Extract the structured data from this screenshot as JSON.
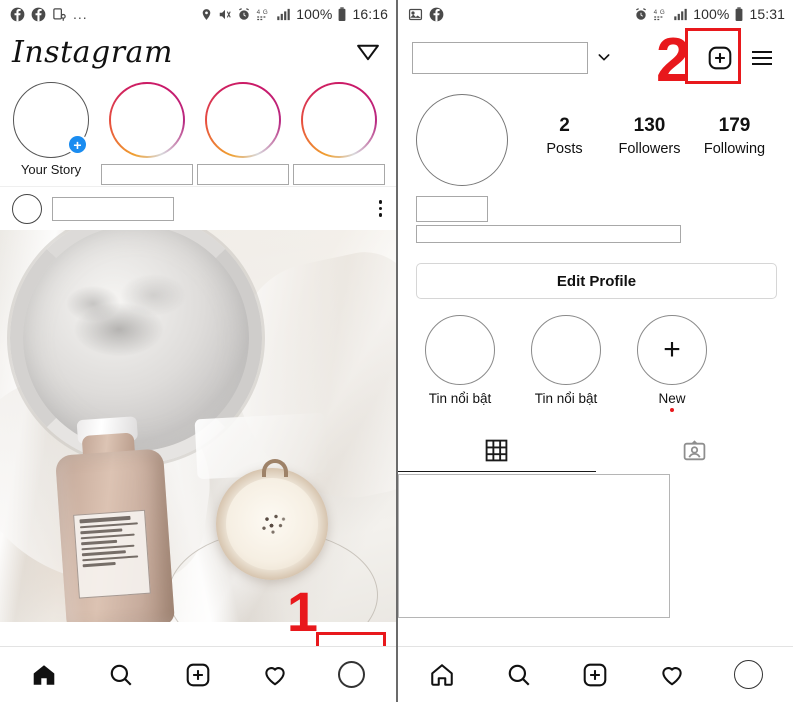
{
  "meta": {
    "app": "Instagram",
    "accent_red": "#e8181c",
    "story_gradient_from": "#f0a030",
    "story_gradient_to": "#c9186a",
    "badge_blue": "#1a8cf0"
  },
  "left_phone": {
    "statusbar": {
      "left_icons": [
        "facebook-icon",
        "facebook-icon",
        "device-location-icon"
      ],
      "overflow": "...",
      "right_icons": [
        "location-pin-icon",
        "mute-vibrate-icon",
        "alarm-icon",
        "4g-icon",
        "signal-bars-icon"
      ],
      "network": "4G",
      "battery": "100%",
      "time": "16:16"
    },
    "header": {
      "logo": "Instagram",
      "messenger_icon": "send-direct-icon"
    },
    "stories": [
      {
        "label": "Your Story",
        "ring": "plain",
        "badge": "+",
        "redacted": false
      },
      {
        "label": "",
        "ring": "gradient",
        "badge": "",
        "redacted": true
      },
      {
        "label": "",
        "ring": "gradient",
        "badge": "",
        "redacted": true
      },
      {
        "label": "",
        "ring": "gradient",
        "badge": "",
        "redacted": true
      }
    ],
    "post": {
      "avatar": "post-author-avatar",
      "username": "",
      "menu_icon": "kebab-menu-icon",
      "image_alt": "Silver ornate tray, chocolate milk bottle and cappuccino cup on cream silk fabric"
    },
    "bottom_nav": [
      {
        "name": "home",
        "icon": "home-icon",
        "active": true
      },
      {
        "name": "search",
        "icon": "search-icon",
        "active": false
      },
      {
        "name": "create",
        "icon": "plus-square-icon",
        "active": false
      },
      {
        "name": "activity",
        "icon": "heart-icon",
        "active": false
      },
      {
        "name": "profile",
        "icon": "profile-avatar-icon",
        "active": false
      }
    ],
    "annotation": {
      "number": "1",
      "target": "profile-avatar-nav-button"
    }
  },
  "right_phone": {
    "statusbar": {
      "left_icons": [
        "photo-icon",
        "facebook-icon"
      ],
      "right_icons": [
        "alarm-icon",
        "4g-icon",
        "signal-bars-icon"
      ],
      "network": "4G",
      "battery": "100%",
      "time": "15:31"
    },
    "header": {
      "username": "",
      "chevron": "chevron-down-icon",
      "add_icon": "plus-square-icon",
      "menu_icon": "hamburger-menu-icon"
    },
    "stats": [
      {
        "num": "2",
        "cap": "Posts"
      },
      {
        "num": "130",
        "cap": "Followers"
      },
      {
        "num": "179",
        "cap": "Following"
      }
    ],
    "bio": {
      "name": "",
      "description": ""
    },
    "edit_profile_label": "Edit Profile",
    "highlights": [
      {
        "cap": "Tin nổi bật",
        "glyph": "",
        "is_new": false
      },
      {
        "cap": "Tin nổi bật",
        "glyph": "",
        "is_new": false
      },
      {
        "cap": "New",
        "glyph": "+",
        "is_new": true
      }
    ],
    "tabs": [
      {
        "name": "grid",
        "icon": "grid-icon",
        "active": true
      },
      {
        "name": "tagged",
        "icon": "tagged-person-icon",
        "active": false
      }
    ],
    "bottom_nav": [
      {
        "name": "home",
        "icon": "home-icon",
        "active": false
      },
      {
        "name": "search",
        "icon": "search-icon",
        "active": false
      },
      {
        "name": "create",
        "icon": "plus-square-icon",
        "active": false
      },
      {
        "name": "activity",
        "icon": "heart-icon",
        "active": false
      },
      {
        "name": "profile",
        "icon": "profile-avatar-icon",
        "active": true
      }
    ],
    "annotation": {
      "number": "2",
      "target": "add-new-post-button"
    }
  }
}
